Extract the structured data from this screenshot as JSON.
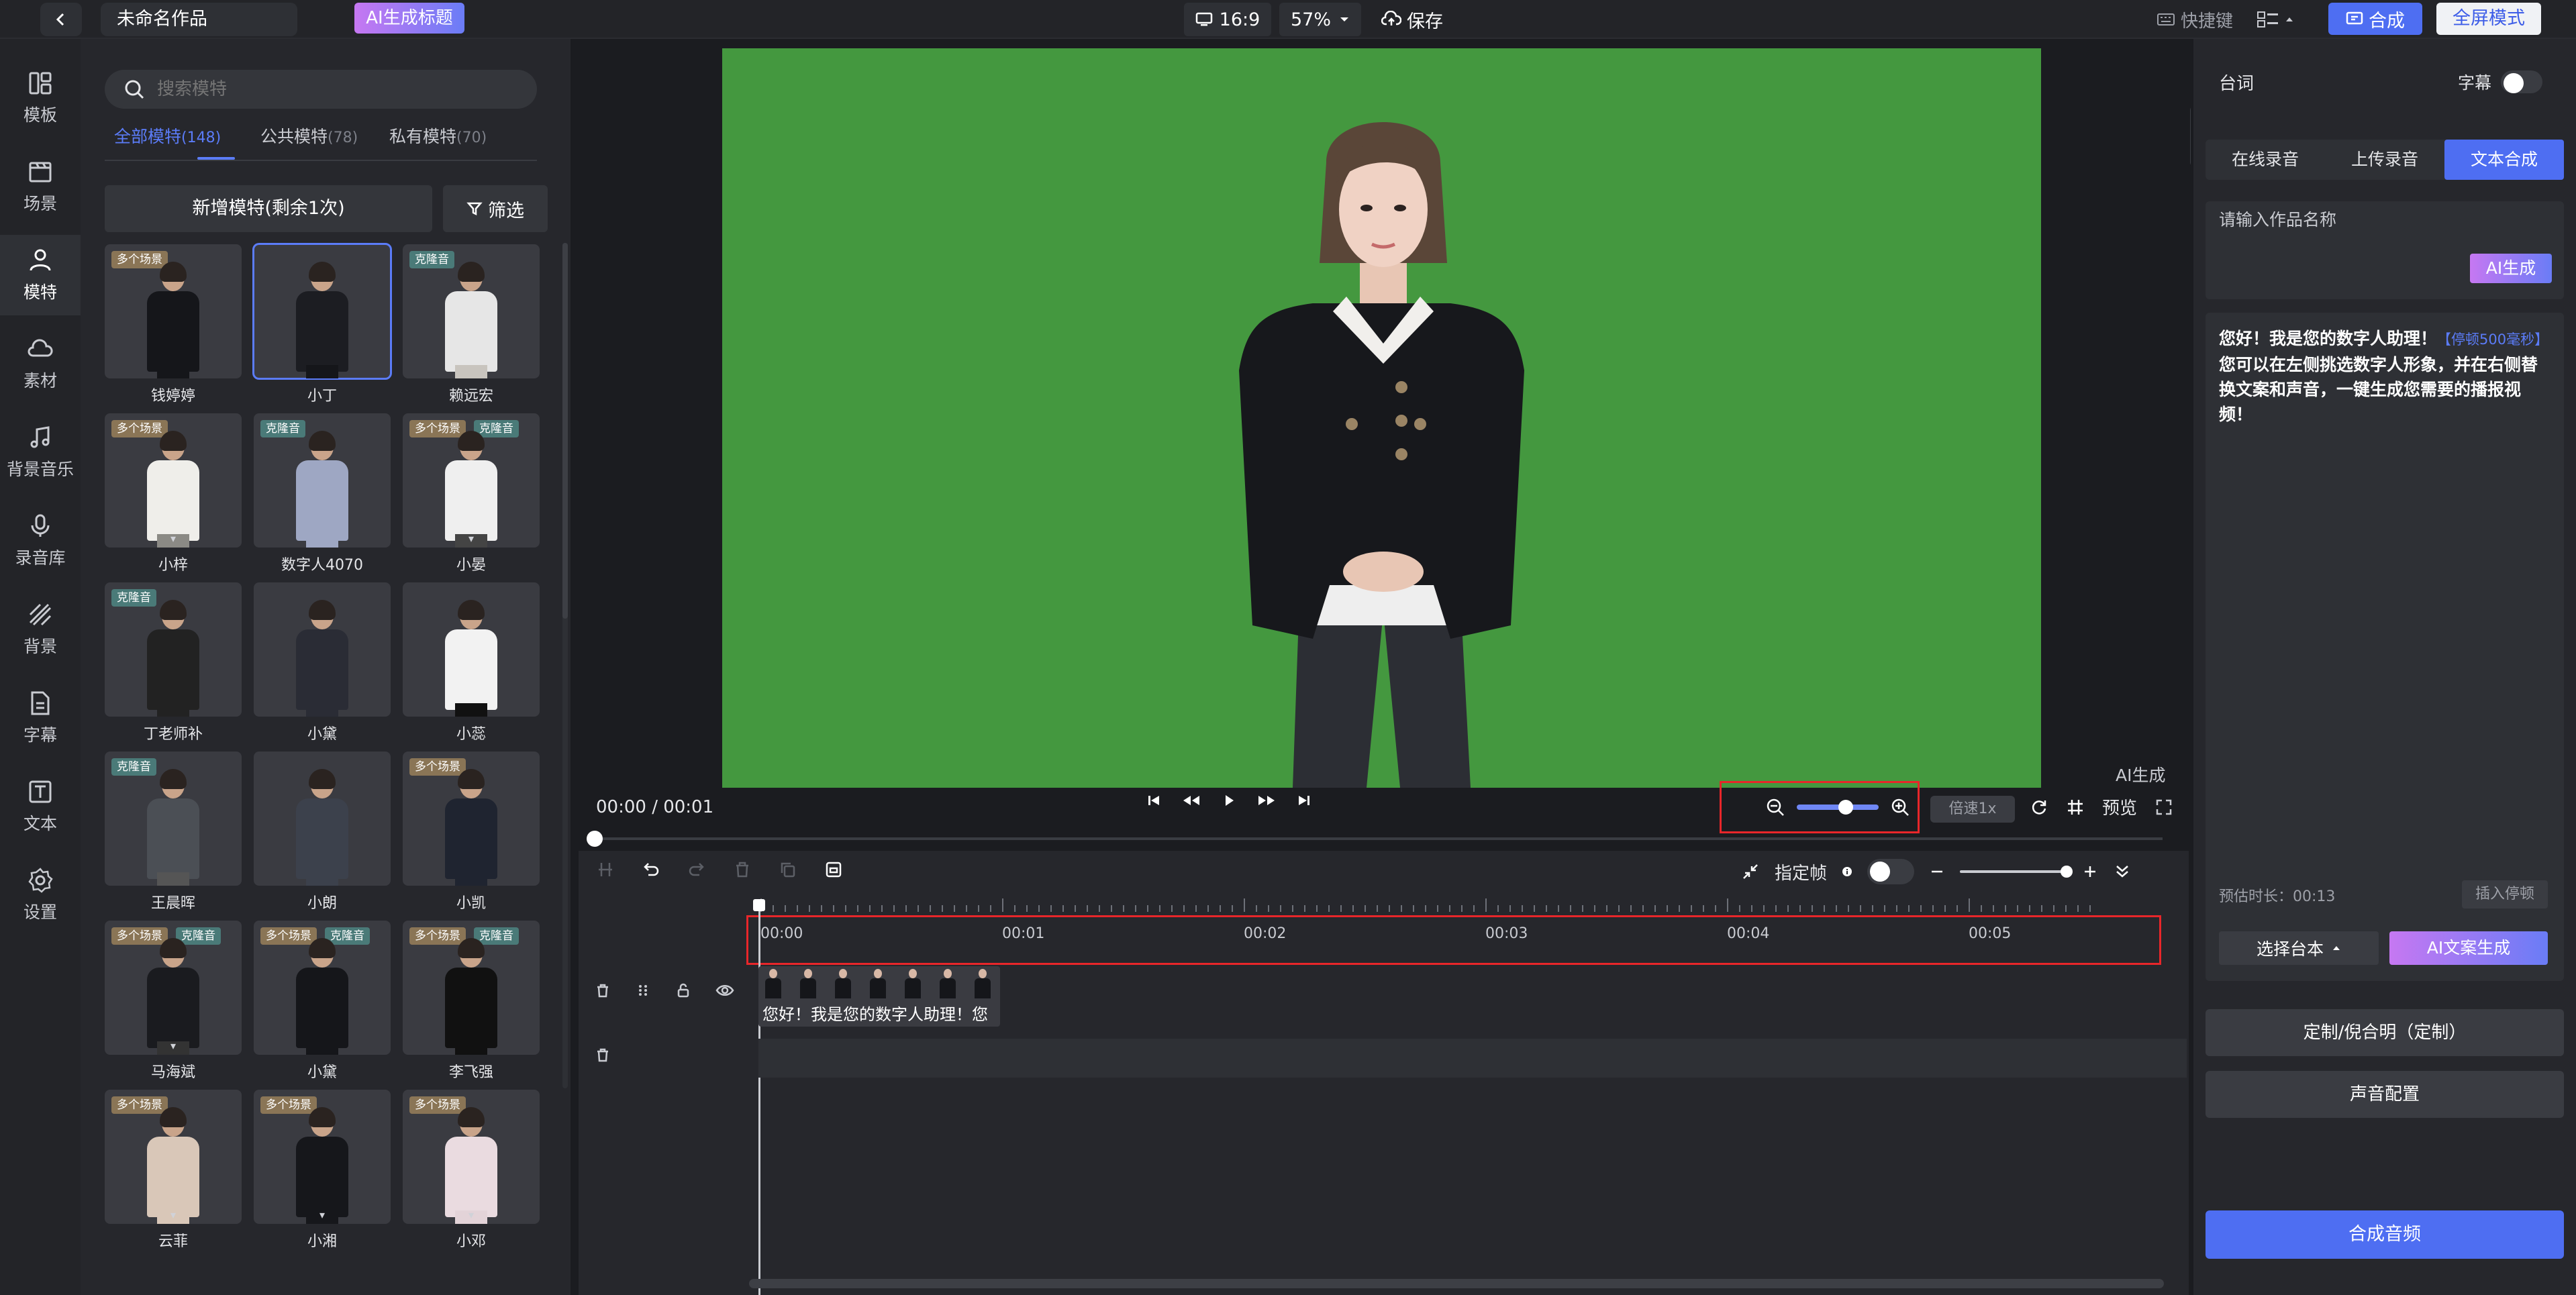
{
  "topbar": {
    "project_title": "未命名作品",
    "ai_title_label": "AI生成标题",
    "aspect_ratio": "16:9",
    "zoom": "57%",
    "save_label": "保存",
    "shortcut_label": "快捷键",
    "compose_label": "合成",
    "fullscreen_label": "全屏模式"
  },
  "nav": [
    {
      "label": "模板",
      "icon": "template-icon"
    },
    {
      "label": "场景",
      "icon": "scene-icon"
    },
    {
      "label": "模特",
      "icon": "model-icon"
    },
    {
      "label": "素材",
      "icon": "material-icon"
    },
    {
      "label": "背景音乐",
      "icon": "music-icon"
    },
    {
      "label": "录音库",
      "icon": "microphone-icon"
    },
    {
      "label": "背景",
      "icon": "background-icon"
    },
    {
      "label": "字幕",
      "icon": "subtitle-icon"
    },
    {
      "label": "文本",
      "icon": "text-icon"
    },
    {
      "label": "设置",
      "icon": "settings-icon"
    }
  ],
  "models": {
    "search_placeholder": "搜索模特",
    "tabs": [
      {
        "label": "全部模特",
        "count": "(148)"
      },
      {
        "label": "公共模特",
        "count": "(78)"
      },
      {
        "label": "私有模特",
        "count": "(70)"
      }
    ],
    "add_label": "新增模特(剩余1次)",
    "filter_label": "筛选",
    "badge_multi": "多个场景",
    "badge_clone": "克隆音",
    "cards": [
      {
        "name": "钱婷婷"
      },
      {
        "name": "小丁"
      },
      {
        "name": "赖远宏"
      },
      {
        "name": "小梓"
      },
      {
        "name": "数字人4070"
      },
      {
        "name": "小晏"
      },
      {
        "name": "丁老师补"
      },
      {
        "name": "小黛"
      },
      {
        "name": "小蕊"
      },
      {
        "name": "王晨晖"
      },
      {
        "name": "小朗"
      },
      {
        "name": "小凯"
      },
      {
        "name": "马海斌"
      },
      {
        "name": "小黛"
      },
      {
        "name": "李飞强"
      },
      {
        "name": "云菲"
      },
      {
        "name": "小湘"
      },
      {
        "name": "小邓"
      }
    ]
  },
  "player": {
    "time": "00:00 / 00:01",
    "speed": "倍速1x",
    "preview": "预览",
    "watermark": "AI生成"
  },
  "timeline": {
    "keyframe_label": "指定帧",
    "ticks": [
      "00:00",
      "00:01",
      "00:02",
      "00:03",
      "00:04",
      "00:05"
    ],
    "clip_text": "您好！我是您的数字人助理！您"
  },
  "right": {
    "title": "台词",
    "subtitle_label": "字幕",
    "tabs": [
      "在线录音",
      "上传录音",
      "文本合成"
    ],
    "name_placeholder": "请输入作品名称",
    "ai_gen_label": "AI生成",
    "script_line1": "您好！我是您的数字人助理！",
    "pause_tag": "【停顿500毫秒】",
    "script_line2": "您可以在左侧挑选数字人形象，并在右侧替换文案和声音，一键生成您需要的播报视频！",
    "est_duration": "预估时长：00:13",
    "insert_pause": "插入停顿",
    "choose_script": "选择台本",
    "ai_copy": "AI文案生成",
    "custom_voice": "定制/倪合明（定制）",
    "voice_config": "声音配置",
    "compose_audio": "合成音频"
  },
  "colors": {
    "accent": "#4e6ef2",
    "greenscreen": "#44983f",
    "highlight_border": "#e8262a"
  }
}
